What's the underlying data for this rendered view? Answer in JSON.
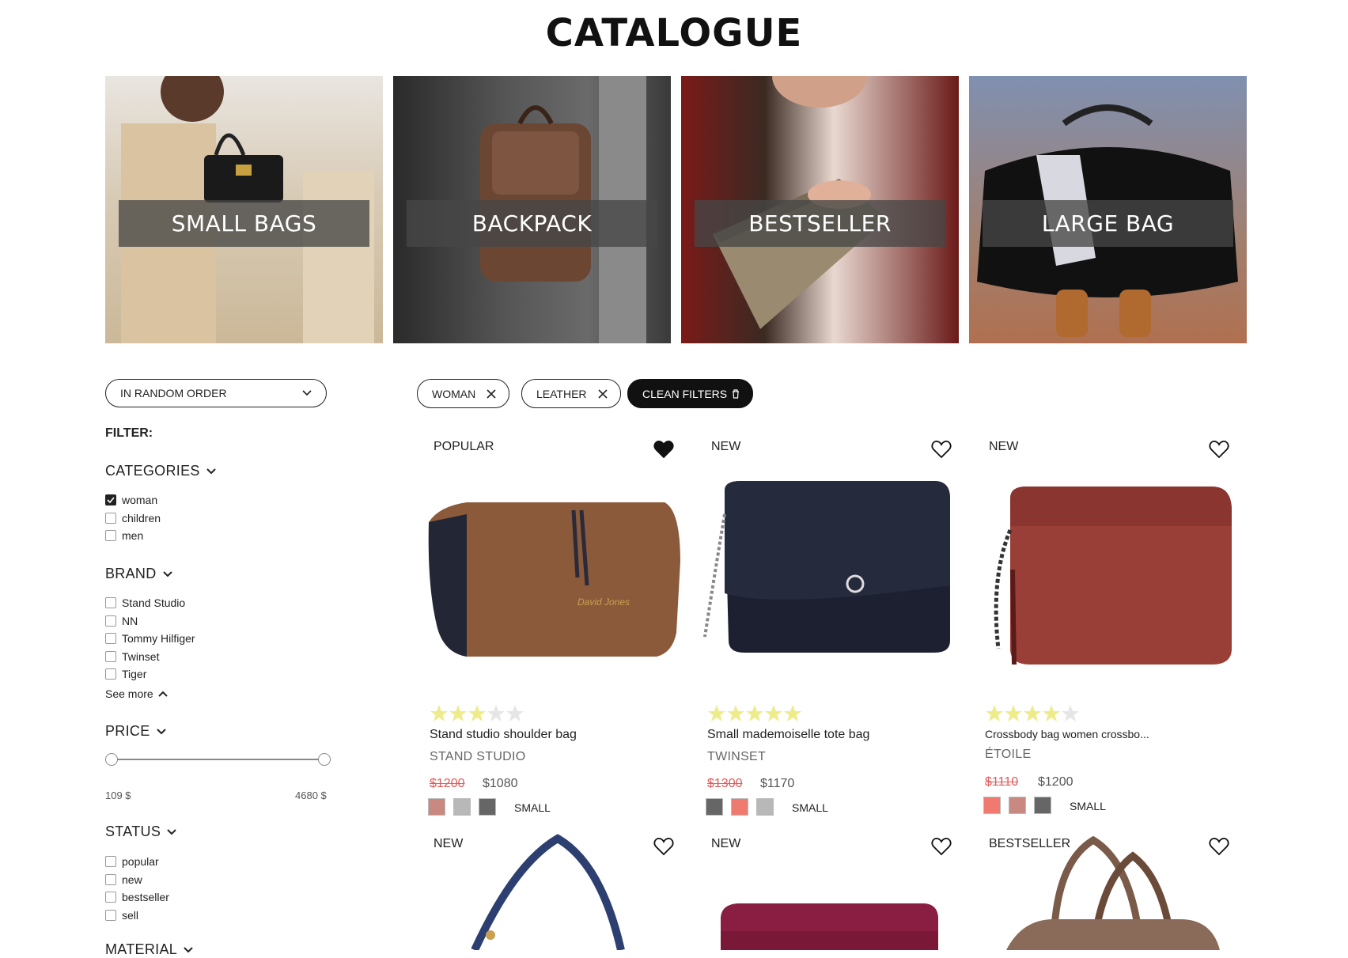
{
  "page": {
    "title": "CATALOGUE"
  },
  "categories": [
    {
      "label": "SMALL BAGS"
    },
    {
      "label": "BACKPACK"
    },
    {
      "label": "BESTSELLER"
    },
    {
      "label": "LARGE BAG"
    }
  ],
  "sort": {
    "label": "IN RANDOM ORDER"
  },
  "active_filters": [
    {
      "label": "WOMAN"
    },
    {
      "label": "LEATHER"
    }
  ],
  "clean_filters": {
    "label": "CLEAN FILTERS"
  },
  "filter": {
    "heading": "FILTER:",
    "categories": {
      "title": "CATEGORIES",
      "items": [
        {
          "label": "woman",
          "checked": true
        },
        {
          "label": "children",
          "checked": false
        },
        {
          "label": "men",
          "checked": false
        }
      ]
    },
    "brand": {
      "title": "BRAND",
      "items": [
        {
          "label": "Stand Studio",
          "checked": false
        },
        {
          "label": "NN",
          "checked": false
        },
        {
          "label": "Tommy Hilfiger",
          "checked": false
        },
        {
          "label": "Twinset",
          "checked": false
        },
        {
          "label": "Tiger",
          "checked": false
        }
      ],
      "see_more": "See more"
    },
    "price": {
      "title": "PRICE",
      "min": "109 $",
      "max": "4680 $"
    },
    "status": {
      "title": "STATUS",
      "items": [
        {
          "label": "popular",
          "checked": false
        },
        {
          "label": "new",
          "checked": false
        },
        {
          "label": "bestseller",
          "checked": false
        },
        {
          "label": "sell",
          "checked": false
        }
      ]
    },
    "material": {
      "title": "MATERIAL"
    }
  },
  "products": [
    {
      "badge": "POPULAR",
      "favorite": true,
      "rating": 3,
      "name": "Stand studio shoulder bag",
      "brand": "STAND STUDIO",
      "old_price": "$1200",
      "price": "$1080",
      "size": "SMALL",
      "swatches": [
        "#c98880",
        "#b8b8b8",
        "#666666"
      ],
      "color": "#8a5a3a"
    },
    {
      "badge": "NEW",
      "favorite": false,
      "rating": 5,
      "name": "Small mademoiselle tote bag",
      "brand": "TWINSET",
      "old_price": "$1300",
      "price": "$1170",
      "size": "SMALL",
      "swatches": [
        "#666666",
        "#ee7a70",
        "#b8b8b8"
      ],
      "color": "#1c2030"
    },
    {
      "badge": "NEW",
      "favorite": false,
      "rating": 4,
      "name": "Crossbody bag women crossbo...",
      "brand": "ÉTOILE",
      "old_price": "$1110",
      "price": "$1200",
      "size": "SMALL",
      "swatches": [
        "#f07a70",
        "#c98880",
        "#666666"
      ],
      "color": "#9a3f38"
    },
    {
      "badge": "NEW",
      "favorite": false,
      "color": "#2c3f70"
    },
    {
      "badge": "NEW",
      "favorite": false,
      "color": "#7a1838"
    },
    {
      "badge": "BESTSELLER",
      "favorite": false,
      "color": "#8a6a58"
    }
  ],
  "icons": {
    "remove": "close-icon",
    "trash": "trash-icon",
    "heart": "heart-icon",
    "chevron": "chevron-down-icon",
    "check": "check-icon"
  }
}
